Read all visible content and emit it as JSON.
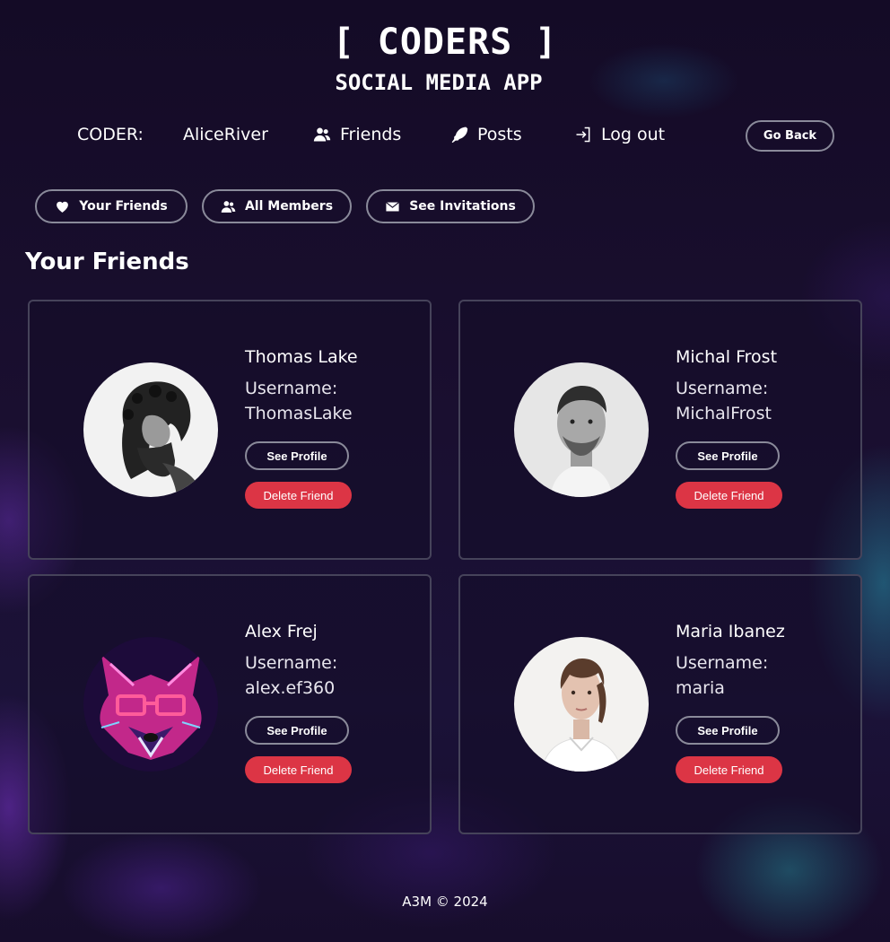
{
  "app": {
    "title": "[ CODERS ]",
    "subtitle": "SOCIAL MEDIA APP"
  },
  "nav": {
    "coder_label": "CODER:",
    "username": "AliceRiver",
    "friends": "Friends",
    "posts": "Posts",
    "logout": "Log out",
    "go_back": "Go Back"
  },
  "tabs": [
    {
      "label": "Your Friends",
      "icon": "heart-icon"
    },
    {
      "label": "All Members",
      "icon": "users-icon"
    },
    {
      "label": "See Invitations",
      "icon": "envelope-icon"
    }
  ],
  "section_title": "Your Friends",
  "friends": [
    {
      "name": "Thomas Lake",
      "username_label": "Username:",
      "username": "ThomasLake",
      "see_profile": "See Profile",
      "delete": "Delete Friend",
      "avatar": "curly-bearded-man-grayscale"
    },
    {
      "name": "Michal Frost",
      "username_label": "Username:",
      "username": "MichalFrost",
      "see_profile": "See Profile",
      "delete": "Delete Friend",
      "avatar": "man-grayscale-portrait"
    },
    {
      "name": "Alex Frej",
      "username_label": "Username:",
      "username": "alex.ef360",
      "see_profile": "See Profile",
      "delete": "Delete Friend",
      "avatar": "neon-raccoon-with-glasses"
    },
    {
      "name": "Maria Ibanez",
      "username_label": "Username:",
      "username": "maria",
      "see_profile": "See Profile",
      "delete": "Delete Friend",
      "avatar": "woman-white-shirt-portrait"
    }
  ],
  "footer": "A3M © 2024",
  "colors": {
    "background": "#140b26",
    "delete_button": "#dc3545",
    "button_border": "#8a8a9a",
    "card_border": "#46435a"
  }
}
